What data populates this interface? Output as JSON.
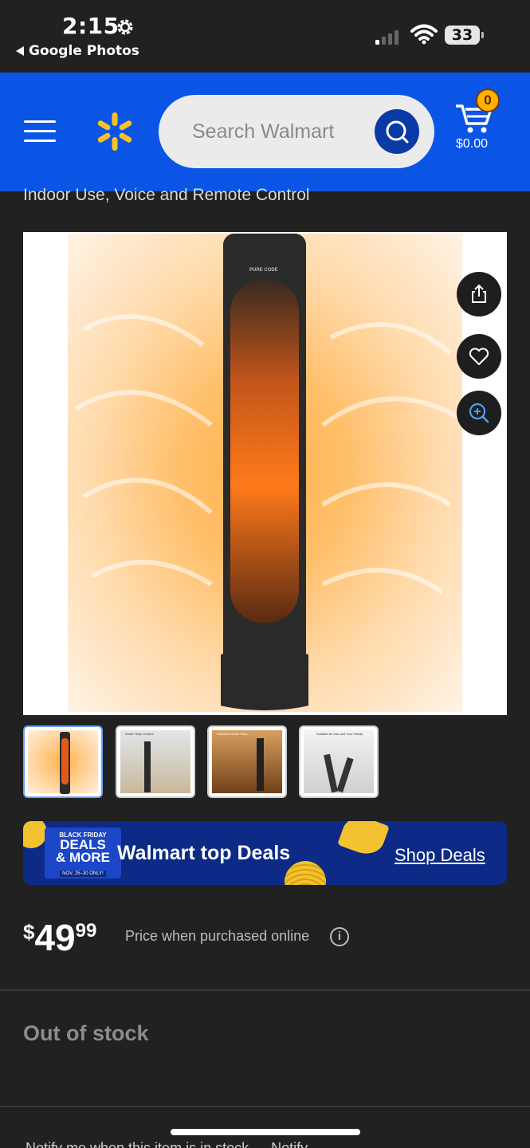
{
  "status_bar": {
    "time": "2:15",
    "back_app": "Google Photos",
    "battery": "33"
  },
  "header": {
    "search_placeholder": "Search Walmart",
    "cart_count": "0",
    "cart_total": "$0.00",
    "brand_color": "#0a55e6",
    "spark_color": "#ffc220"
  },
  "product": {
    "title_tail": "Indoor Use, Voice and Remote Control",
    "image_brand_text": "PURE CODE",
    "actions": [
      "share-icon",
      "heart-icon",
      "zoom-in-icon"
    ],
    "thumbnails": [
      {
        "caption": ""
      },
      {
        "caption": "Smart Temp Control"
      },
      {
        "caption": "Efficient Control Shop"
      },
      {
        "caption": "Suitable for Use and Your Family"
      }
    ]
  },
  "banner": {
    "badge_small": "BLACK FRIDAY",
    "badge_line1": "DEALS",
    "badge_line2": "& MORE",
    "badge_dates": "NOV. 25–30 ONLY!",
    "title": "Walmart top Deals",
    "link": "Shop Deals"
  },
  "price": {
    "currency": "$",
    "whole": "49",
    "cents": "99",
    "note": "Price when purchased online"
  },
  "availability": {
    "status": "Out of stock",
    "notify_text": "Notify me when this item is in stock — Notify"
  }
}
